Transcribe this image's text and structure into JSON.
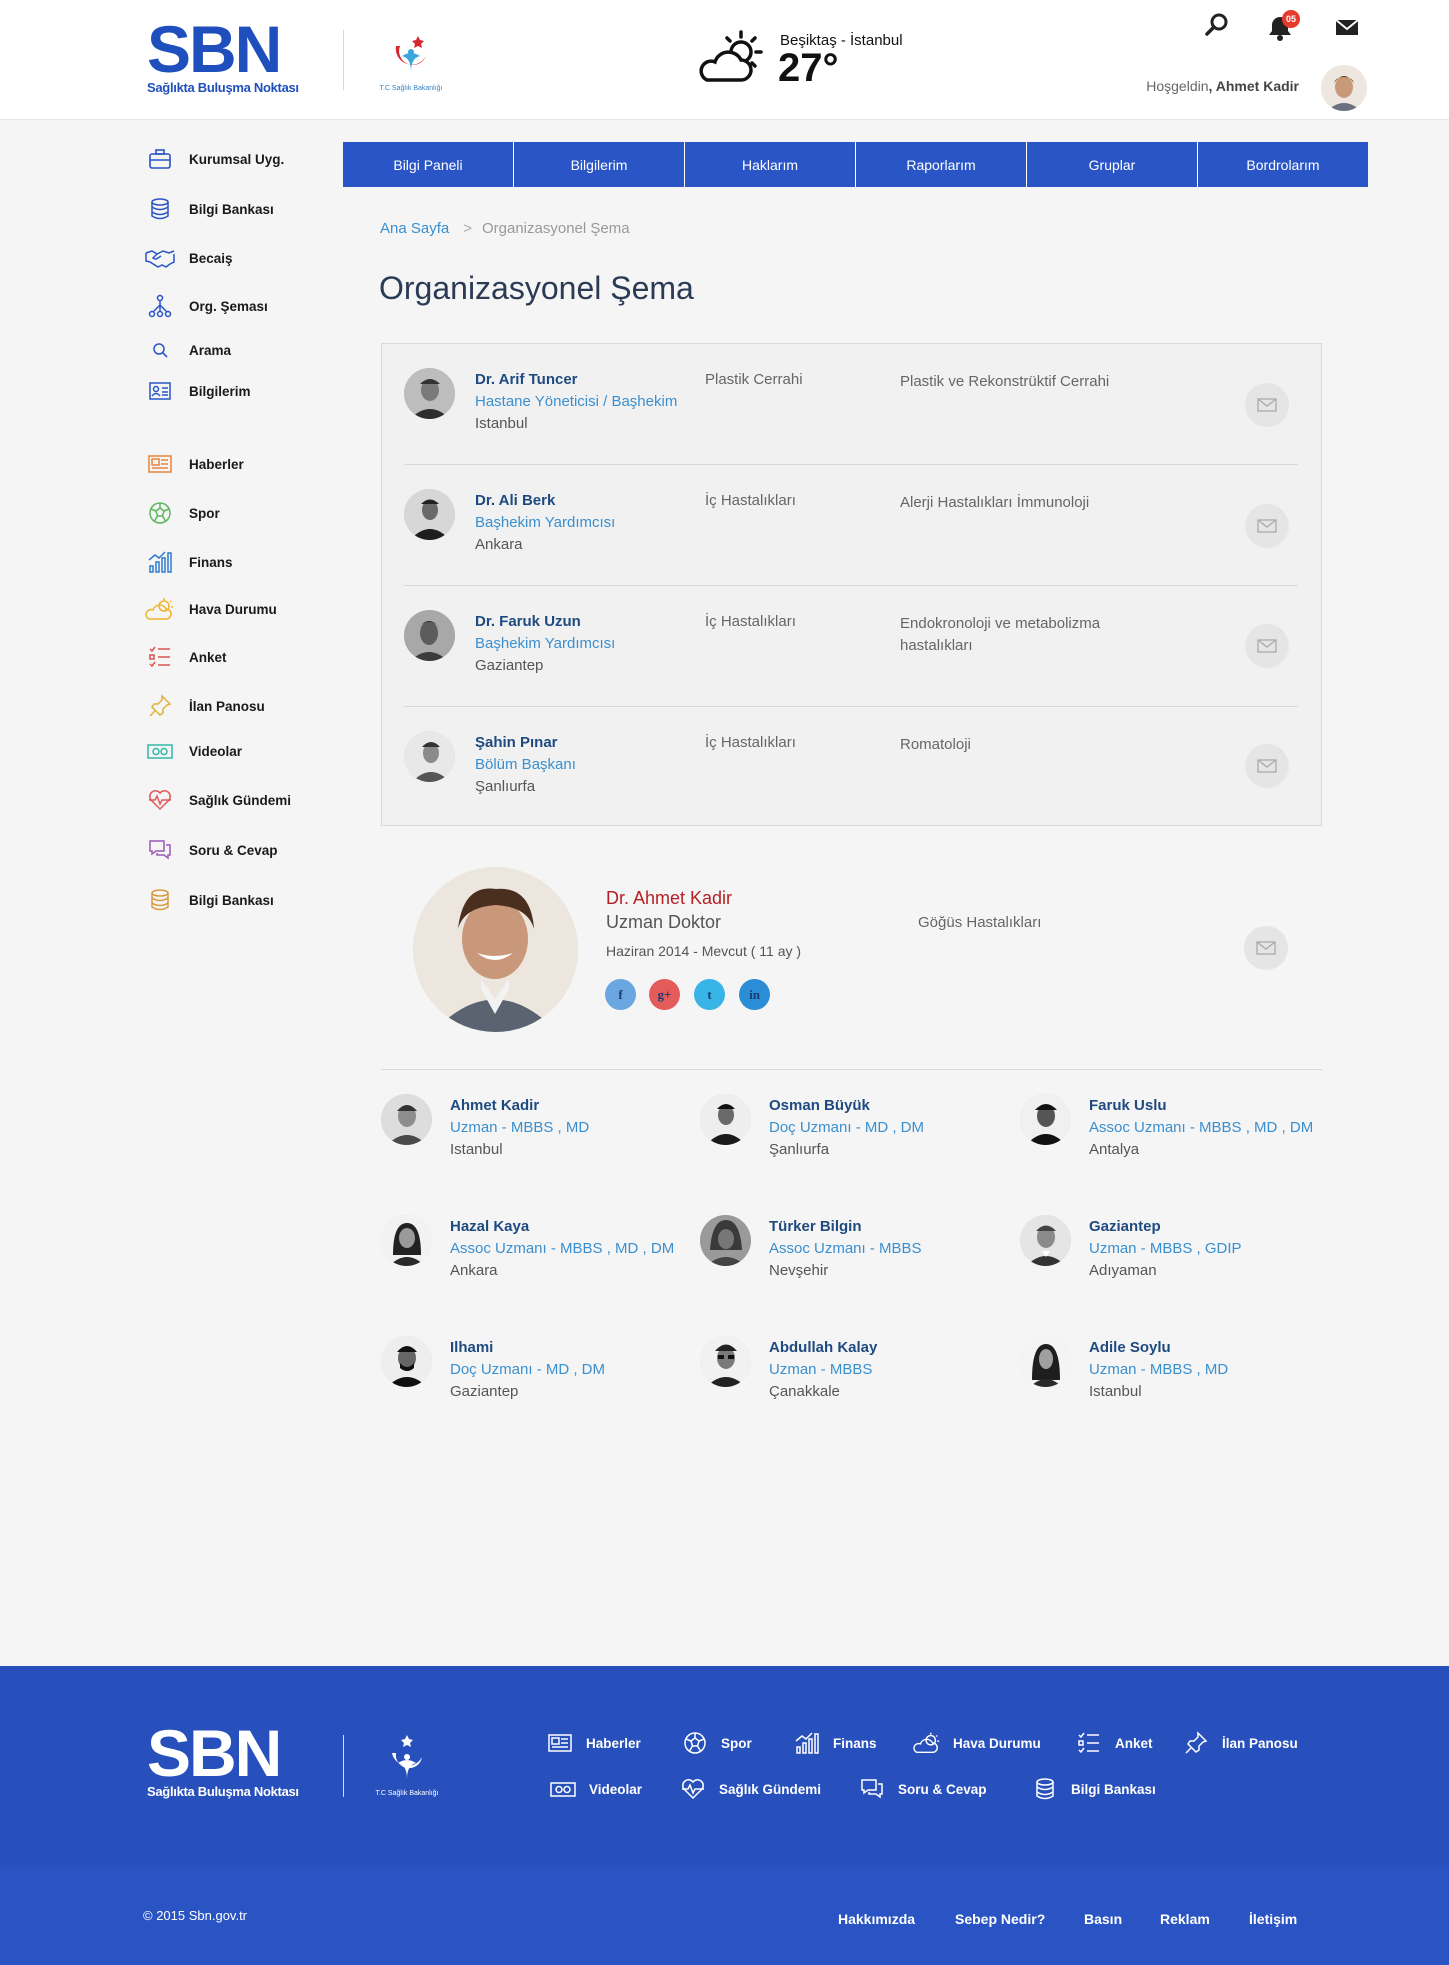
{
  "header": {
    "logo_text": "SBN",
    "logo_subtitle": "Sağlıkta Buluşma Noktası",
    "ministry_label": "T.C Sağlık Bakanlığı",
    "weather": {
      "location": "Beşiktaş - İstanbul",
      "temperature": "27°",
      "icon": "partly-cloudy-icon"
    },
    "notification_count": "05",
    "welcome_prefix": "Hoşgeldin",
    "welcome_name": ", Ahmet Kadir"
  },
  "sidebar": {
    "group1": [
      {
        "label": "Kurumsal Uyg.",
        "icon": "briefcase-icon"
      },
      {
        "label": "Bilgi Bankası",
        "icon": "database-icon"
      },
      {
        "label": "Becaiş",
        "icon": "handshake-icon"
      },
      {
        "label": "Org. Şeması",
        "icon": "org-chart-icon"
      },
      {
        "label": "Arama",
        "icon": "search-icon"
      },
      {
        "label": "Bilgilerim",
        "icon": "id-card-icon"
      }
    ],
    "group2": [
      {
        "label": "Haberler",
        "icon": "newspaper-icon",
        "color": "#e8833a"
      },
      {
        "label": "Spor",
        "icon": "ball-icon",
        "color": "#5cb85c"
      },
      {
        "label": "Finans",
        "icon": "finance-icon",
        "color": "#2e7bd1"
      },
      {
        "label": "Hava Durumu",
        "icon": "weather-icon",
        "color": "#f0b429"
      },
      {
        "label": "Anket",
        "icon": "survey-icon",
        "color": "#d9534f"
      },
      {
        "label": "İlan Panosu",
        "icon": "pin-icon",
        "color": "#e0b23a"
      },
      {
        "label": "Videolar",
        "icon": "video-icon",
        "color": "#2eb8a6"
      },
      {
        "label": "Sağlık Gündemi",
        "icon": "heart-pulse-icon",
        "color": "#e05a5a"
      },
      {
        "label": "Soru & Cevap",
        "icon": "chat-icon",
        "color": "#9b59b6"
      },
      {
        "label": "Bilgi Bankası",
        "icon": "database-icon",
        "color": "#d69a3c"
      }
    ]
  },
  "topnav": [
    "Bilgi Paneli",
    "Bilgilerim",
    "Haklarım",
    "Raporlarım",
    "Gruplar",
    "Bordrolarım"
  ],
  "breadcrumb": {
    "home": "Ana Sayfa",
    "separator": ">",
    "current": "Organizasyonel Şema"
  },
  "page_title": "Organizasyonel Şema",
  "org_rows": [
    {
      "name": "Dr. Arif Tuncer",
      "title": "Hastane Yöneticisi / Başhekim",
      "city": "Istanbul",
      "department": "Plastik Cerrahi",
      "specialty": "Plastik ve Rekonstrüktif Cerrahi"
    },
    {
      "name": "Dr. Ali Berk",
      "title": "Başhekim Yardımcısı",
      "city": "Ankara",
      "department": "İç Hastalıkları",
      "specialty": "Alerji Hastalıkları İmmunoloji"
    },
    {
      "name": "Dr. Faruk Uzun",
      "title": "Başhekim Yardımcısı",
      "city": "Gaziantep",
      "department": "İç Hastalıkları",
      "specialty": "Endokronoloji ve metabolizma hastalıkları"
    },
    {
      "name": "Şahin Pınar",
      "title": "Bölüm Başkanı",
      "city": "Şanlıurfa",
      "department": "İç Hastalıkları",
      "specialty": "Romatoloji"
    }
  ],
  "profile": {
    "name": "Dr. Ahmet Kadir",
    "role": "Uzman Doktor",
    "period": "Haziran 2014 - Mevcut ( 11 ay )",
    "specialty": "Göğüs Hastalıkları",
    "social": [
      {
        "label": "f",
        "icon": "facebook-icon",
        "color": "#6aa6e0"
      },
      {
        "label": "g+",
        "icon": "google-plus-icon",
        "color": "#e35b5b"
      },
      {
        "label": "t",
        "icon": "twitter-icon",
        "color": "#39b4e6"
      },
      {
        "label": "in",
        "icon": "linkedin-icon",
        "color": "#2a8dd6"
      }
    ]
  },
  "people": [
    {
      "name": "Ahmet Kadir",
      "title": "Uzman - MBBS , MD",
      "city": "Istanbul"
    },
    {
      "name": "Osman Büyük",
      "title": "Doç Uzmanı - MD , DM",
      "city": "Şanlıurfa"
    },
    {
      "name": "Faruk Uslu",
      "title": "Assoc Uzmanı - MBBS , MD , DM",
      "city": "Antalya"
    },
    {
      "name": "Hazal Kaya",
      "title": "Assoc Uzmanı - MBBS , MD , DM",
      "city": "Ankara"
    },
    {
      "name": "Türker Bilgin",
      "title": "Assoc Uzmanı - MBBS",
      "city": "Nevşehir"
    },
    {
      "name": "Gaziantep",
      "title": "Uzman - MBBS , GDIP",
      "city": "Adıyaman"
    },
    {
      "name": "Ilhami",
      "title": "Doç Uzmanı - MD , DM",
      "city": "Gaziantep"
    },
    {
      "name": "Abdullah Kalay",
      "title": "Uzman - MBBS",
      "city": "Çanakkale"
    },
    {
      "name": "Adile Soylu",
      "title": "Uzman - MBBS , MD",
      "city": "Istanbul"
    }
  ],
  "footer": {
    "links_row1": [
      "Haberler",
      "Spor",
      "Finans",
      "Hava Durumu",
      "Anket",
      "İlan Panosu"
    ],
    "links_row2": [
      "Videolar",
      "Sağlık Gündemi",
      "Soru & Cevap",
      "Bilgi Bankası"
    ],
    "copyright": "© 2015 Sbn.gov.tr",
    "bottom_links": [
      "Hakkımızda",
      "Sebep Nedir?",
      "Basın",
      "Reklam",
      "İletişim"
    ]
  }
}
